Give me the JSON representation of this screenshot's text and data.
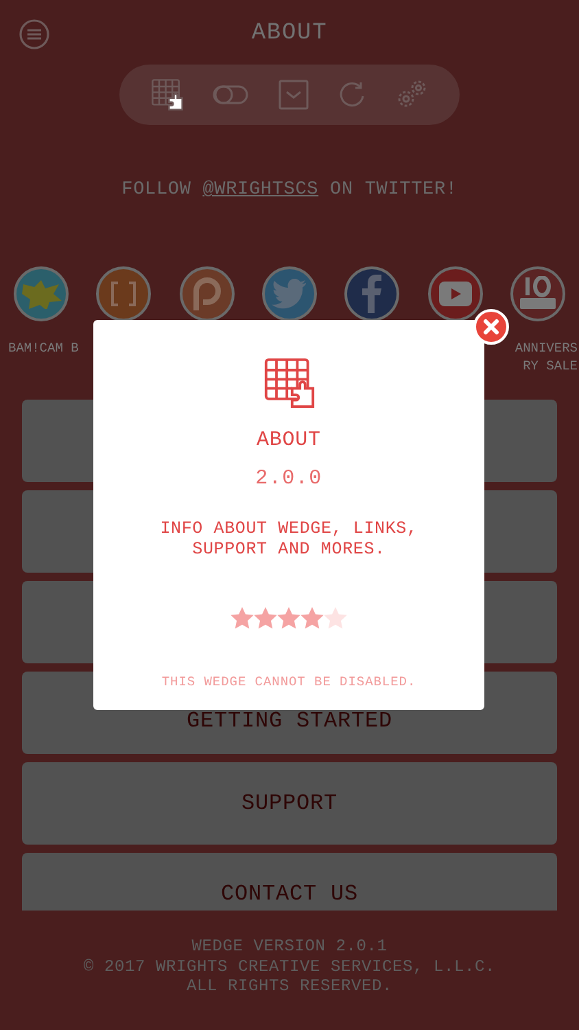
{
  "header": {
    "title": "ABOUT"
  },
  "follow": {
    "before": "FOLLOW ",
    "handle": "@WRIGHTSCS",
    "after": " ON TWITTER!"
  },
  "apps": [
    {
      "kind": "bamcam",
      "label": "BAM!CAM B"
    },
    {
      "kind": "bracket"
    },
    {
      "kind": "patreon"
    },
    {
      "kind": "twitter"
    },
    {
      "kind": "facebook"
    },
    {
      "kind": "youtube"
    },
    {
      "kind": "years",
      "label_lines": [
        "ANNIVERS",
        "RY SALE"
      ]
    }
  ],
  "menu": [
    {
      "kind": "covered"
    },
    {
      "kind": "covered"
    },
    {
      "kind": "covered"
    },
    {
      "kind": "button",
      "label": "GETTING STARTED"
    },
    {
      "kind": "button",
      "label": "SUPPORT"
    },
    {
      "kind": "button",
      "label": "CONTACT US"
    }
  ],
  "footer": [
    "WEDGE VERSION 2.0.1",
    "© 2017 WRIGHTS CREATIVE SERVICES, L.L.C.",
    "ALL RIGHTS RESERVED."
  ],
  "modal": {
    "title": "ABOUT",
    "version": "2.0.0",
    "description": "INFO ABOUT WEDGE, LINKS, SUPPORT AND MORES.",
    "stars": 4,
    "note": "THIS WEDGE CANNOT BE DISABLED."
  }
}
